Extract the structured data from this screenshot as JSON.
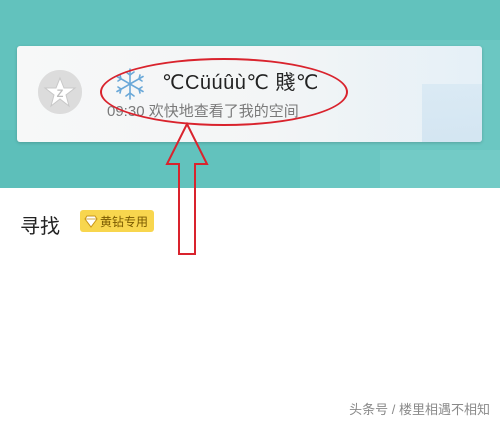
{
  "notification": {
    "title": "℃Cüúûù℃ 賤℃",
    "subtitle": "09:30 欢快地查看了我的空间"
  },
  "section": {
    "title": "寻找",
    "badge_label": "黄钻专用"
  },
  "watermark": "头条号 / 楼里相遇不相知",
  "colors": {
    "header_bg": "#62c2bd",
    "annotation_red": "#d9232d",
    "badge_yellow": "#f8d64e"
  },
  "icons": {
    "avatar": "qzone-star-icon",
    "snowflake": "snowflake-icon",
    "badge": "diamond-icon",
    "annotation": "up-arrow-icon"
  }
}
